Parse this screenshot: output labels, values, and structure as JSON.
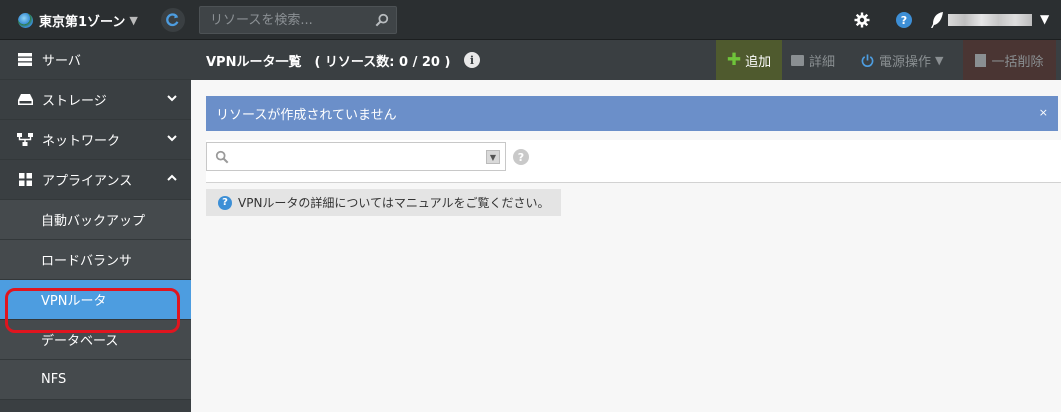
{
  "header": {
    "zone_label": "東京第1ゾーン",
    "zone_caret": "▼",
    "search_placeholder": "リソースを検索...",
    "help_glyph": "?",
    "user_caret": "▼"
  },
  "sidebar": {
    "items": [
      {
        "label": "サーバ",
        "icon": "server-icon"
      },
      {
        "label": "ストレージ",
        "icon": "disk-icon",
        "expandable": true
      },
      {
        "label": "ネットワーク",
        "icon": "network-icon",
        "expandable": true
      },
      {
        "label": "アプライアンス",
        "icon": "appliance-icon",
        "expanded": true
      }
    ],
    "sub_items": [
      {
        "label": "自動バックアップ"
      },
      {
        "label": "ロードバランサ"
      },
      {
        "label": "VPNルータ",
        "active": true
      },
      {
        "label": "データベース"
      },
      {
        "label": "NFS"
      }
    ]
  },
  "content_header": {
    "title": "VPNルータ一覧　( リソース数: 0 / 20 )",
    "info_glyph": "i",
    "add_label": "追加",
    "add_glyph": "✚",
    "detail_label": "詳細",
    "power_label": "電源操作",
    "power_caret": "▼",
    "delete_label": "一括削除"
  },
  "alert": {
    "message": "リソースが作成されていません",
    "close_glyph": "×"
  },
  "filter": {
    "placeholder": "",
    "help_glyph": "?",
    "dropdown_glyph": "▼"
  },
  "note": {
    "glyph": "?",
    "text_before": "VPNルータの詳細については",
    "link_text": "マニュアル",
    "text_after": "をご覧ください。"
  },
  "colors": {
    "topbar": "#2b2f31",
    "sidebar": "#3a3f42",
    "active_item": "#4d9de0",
    "alert": "#6b8fc9",
    "add_button": "#4f5a2e",
    "delete_button": "#4a3533",
    "highlight_ring": "#e0151f"
  }
}
